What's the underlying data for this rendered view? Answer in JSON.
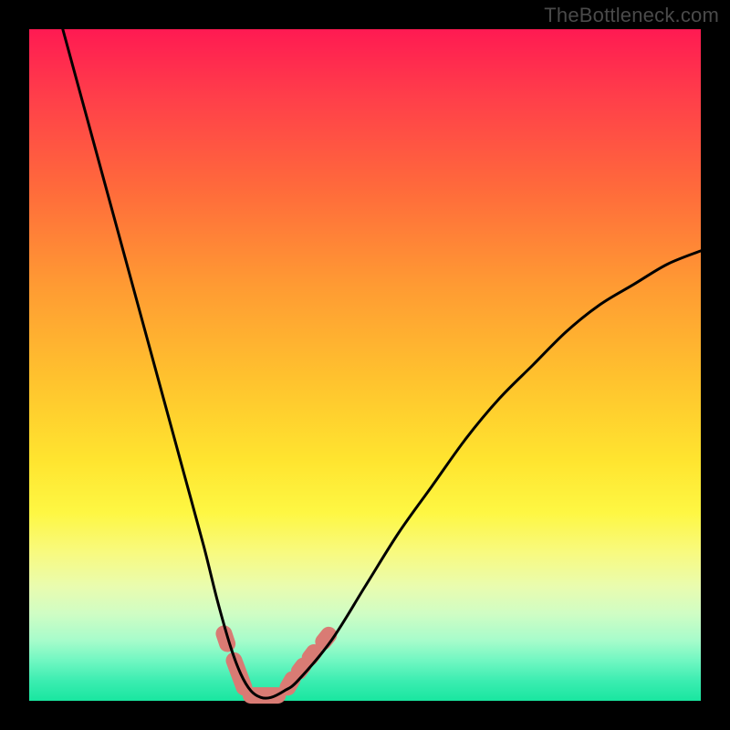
{
  "watermark": "TheBottleneck.com",
  "chart_data": {
    "type": "line",
    "title": "",
    "xlabel": "",
    "ylabel": "",
    "xlim": [
      0,
      100
    ],
    "ylim": [
      0,
      100
    ],
    "grid": false,
    "legend": false,
    "series": [
      {
        "name": "bottleneck-curve",
        "x": [
          5,
          8,
          11,
          14,
          17,
          20,
          23,
          26,
          28,
          30,
          31.5,
          33,
          34.5,
          36,
          38,
          40,
          45,
          50,
          55,
          60,
          65,
          70,
          75,
          80,
          85,
          90,
          95,
          100
        ],
        "y": [
          100,
          89,
          78,
          67,
          56,
          45,
          34,
          23,
          15,
          8,
          4,
          1.5,
          0.5,
          0.5,
          1.5,
          3,
          9,
          17,
          25,
          32,
          39,
          45,
          50,
          55,
          59,
          62,
          65,
          67
        ],
        "color": "#000000"
      }
    ],
    "markers": {
      "name": "trough-pills",
      "color": "#d97b74",
      "segments": [
        {
          "x1": 29.0,
          "y1": 10.0,
          "x2": 29.5,
          "y2": 8.5,
          "cap": "round"
        },
        {
          "x1": 30.5,
          "y1": 6.0,
          "x2": 32.0,
          "y2": 2.0,
          "cap": "round"
        },
        {
          "x1": 33.0,
          "y1": 0.8,
          "x2": 37.0,
          "y2": 0.8,
          "cap": "round"
        },
        {
          "x1": 38.5,
          "y1": 2.0,
          "x2": 39.2,
          "y2": 3.2,
          "cap": "round"
        },
        {
          "x1": 40.2,
          "y1": 4.4,
          "x2": 40.8,
          "y2": 5.2,
          "cap": "round"
        },
        {
          "x1": 41.8,
          "y1": 6.4,
          "x2": 42.4,
          "y2": 7.2,
          "cap": "round"
        },
        {
          "x1": 43.8,
          "y1": 8.8,
          "x2": 44.6,
          "y2": 9.8,
          "cap": "round"
        }
      ]
    }
  }
}
